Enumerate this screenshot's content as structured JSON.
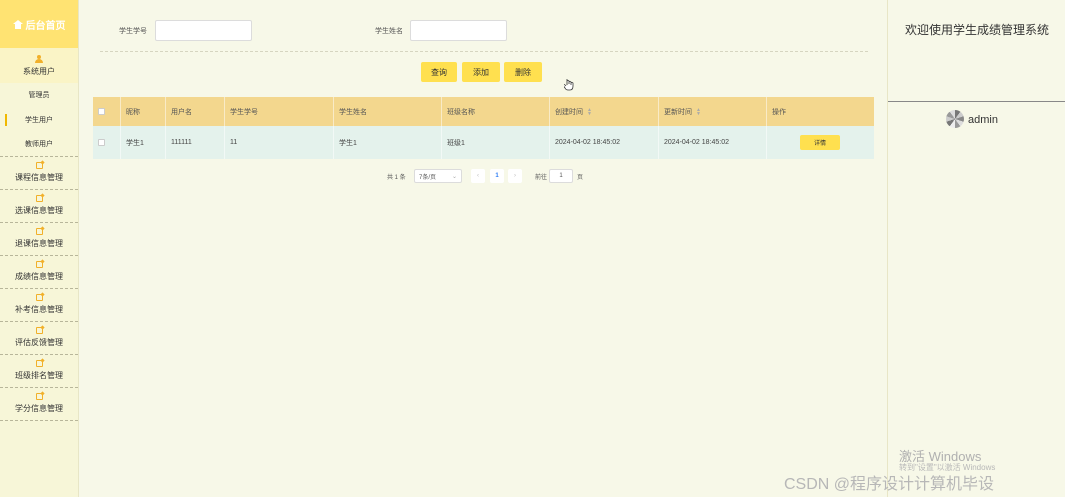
{
  "sidebar": {
    "brand": "后台首页",
    "system_user": "系统用户",
    "sub_items": [
      "管理员",
      "学生用户",
      "教师用户"
    ],
    "active_sub": "学生用户",
    "groups": [
      "课程信息管理",
      "选课信息管理",
      "退课信息管理",
      "成绩信息管理",
      "补考信息管理",
      "评估反馈管理",
      "班级排名管理",
      "学分信息管理"
    ]
  },
  "search": {
    "student_no_label": "学生学号",
    "student_no_value": "",
    "student_name_label": "学生姓名",
    "student_name_value": ""
  },
  "actions": {
    "query": "查询",
    "add": "添加",
    "delete": "删除"
  },
  "table": {
    "columns": [
      "昵称",
      "用户名",
      "学生学号",
      "学生姓名",
      "班级名称",
      "创建时间",
      "更新时间",
      "操作"
    ],
    "rows": [
      {
        "nickname": "学生1",
        "username": "111111",
        "student_no": "11",
        "student_name": "学生1",
        "class_name": "班级1",
        "created": "2024-04-02 18:45:02",
        "updated": "2024-04-02 18:45:02",
        "action": "详情"
      }
    ]
  },
  "pagination": {
    "total_text": "共 1 条",
    "page_size": "7条/页",
    "current_page": "1",
    "goto_label": "前往",
    "goto_value": "1",
    "page_suffix": "页"
  },
  "right": {
    "welcome": "欢迎使用学生成绩管理系统",
    "username": "admin"
  },
  "watermarks": {
    "win_activate": "激活 Windows",
    "win_sub": "转到\"设置\"以激活 Windows",
    "csdn": "CSDN @程序设计计算机毕设"
  },
  "colors": {
    "brand_bg": "#ffe372",
    "button": "#ffe04f",
    "table_header": "#f3d78e",
    "table_row": "#e4f2ec",
    "page_bg": "#f7f8e8"
  }
}
